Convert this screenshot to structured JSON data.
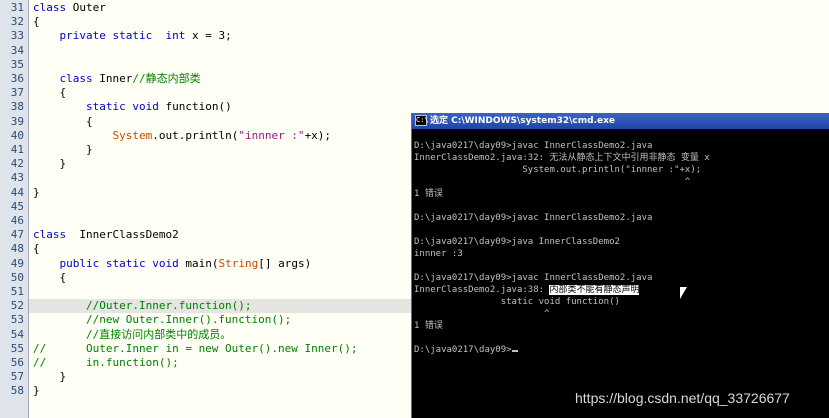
{
  "editor": {
    "line_numbers": [
      "31",
      "32",
      "33",
      "34",
      "35",
      "36",
      "37",
      "38",
      "39",
      "40",
      "41",
      "42",
      "43",
      "44",
      "45",
      "46",
      "47",
      "48",
      "49",
      "50",
      "51",
      "52",
      "53",
      "54",
      "55",
      "56",
      "57",
      "58"
    ],
    "lines": [
      [
        {
          "t": "class",
          "c": "kw"
        },
        {
          "t": " Outer",
          "c": ""
        }
      ],
      [
        {
          "t": "{",
          "c": ""
        }
      ],
      [
        {
          "t": "    ",
          "c": ""
        },
        {
          "t": "private",
          "c": "kw"
        },
        {
          "t": " ",
          "c": ""
        },
        {
          "t": "static",
          "c": "kw"
        },
        {
          "t": "  ",
          "c": ""
        },
        {
          "t": "int",
          "c": "ty"
        },
        {
          "t": " x = 3;",
          "c": ""
        }
      ],
      [],
      [],
      [
        {
          "t": "    ",
          "c": ""
        },
        {
          "t": "class",
          "c": "kw"
        },
        {
          "t": " Inner",
          "c": ""
        },
        {
          "t": "//静态内部类",
          "c": "cm"
        }
      ],
      [
        {
          "t": "    {",
          "c": ""
        }
      ],
      [
        {
          "t": "        ",
          "c": ""
        },
        {
          "t": "static",
          "c": "kw"
        },
        {
          "t": " ",
          "c": ""
        },
        {
          "t": "void",
          "c": "kw"
        },
        {
          "t": " function()",
          "c": ""
        }
      ],
      [
        {
          "t": "        {",
          "c": ""
        }
      ],
      [
        {
          "t": "            ",
          "c": ""
        },
        {
          "t": "System",
          "c": "cls"
        },
        {
          "t": ".out.println(",
          "c": ""
        },
        {
          "t": "\"innner :\"",
          "c": "str"
        },
        {
          "t": "+x);",
          "c": ""
        }
      ],
      [
        {
          "t": "        }",
          "c": ""
        }
      ],
      [
        {
          "t": "    }",
          "c": ""
        }
      ],
      [],
      [
        {
          "t": "}",
          "c": ""
        }
      ],
      [],
      [],
      [
        {
          "t": "class",
          "c": "kw"
        },
        {
          "t": "  InnerClassDemo2",
          "c": ""
        }
      ],
      [
        {
          "t": "{",
          "c": ""
        }
      ],
      [
        {
          "t": "    ",
          "c": ""
        },
        {
          "t": "public",
          "c": "kw"
        },
        {
          "t": " ",
          "c": ""
        },
        {
          "t": "static",
          "c": "kw"
        },
        {
          "t": " ",
          "c": ""
        },
        {
          "t": "void",
          "c": "kw"
        },
        {
          "t": " main(",
          "c": ""
        },
        {
          "t": "String",
          "c": "cls"
        },
        {
          "t": "[] args)",
          "c": ""
        }
      ],
      [
        {
          "t": "    {",
          "c": ""
        }
      ],
      [],
      [
        {
          "t": "        ",
          "c": ""
        },
        {
          "t": "//Outer.Inner.function();",
          "c": "cm"
        }
      ],
      [
        {
          "t": "        ",
          "c": ""
        },
        {
          "t": "//new Outer.Inner().function();",
          "c": "cm"
        }
      ],
      [
        {
          "t": "        ",
          "c": ""
        },
        {
          "t": "//直接访问内部类中的成员。",
          "c": "cm"
        }
      ],
      [
        {
          "t": "//      Outer.Inner in = new Outer().new Inner();",
          "c": "cm"
        }
      ],
      [
        {
          "t": "//      in.function();",
          "c": "cm"
        }
      ],
      [
        {
          "t": "    }",
          "c": ""
        }
      ],
      [
        {
          "t": "}",
          "c": ""
        }
      ]
    ]
  },
  "cmd": {
    "icon_text": "C:\\",
    "title": "选定 C:\\WINDOWS\\system32\\cmd.exe",
    "lines": [
      "D:\\java0217\\day09>javac InnerClassDemo2.java",
      "InnerClassDemo2.java:32: 无法从静态上下文中引用非静态 变量 x",
      "                    System.out.println(\"innner :\"+x);",
      "                                                  ^",
      "1 错误",
      "",
      "D:\\java0217\\day09>javac InnerClassDemo2.java",
      "",
      "D:\\java0217\\day09>java InnerClassDemo2",
      "innner :3",
      "",
      "D:\\java0217\\day09>javac InnerClassDemo2.java",
      "InnerClassDemo2.java:38: ",
      "                static void function()",
      "                        ^",
      "1 错误",
      "",
      "D:\\java0217\\day09>"
    ],
    "selected_text": "内部类不能有静态声明"
  },
  "watermark": "https://blog.csdn.net/qq_33726677"
}
